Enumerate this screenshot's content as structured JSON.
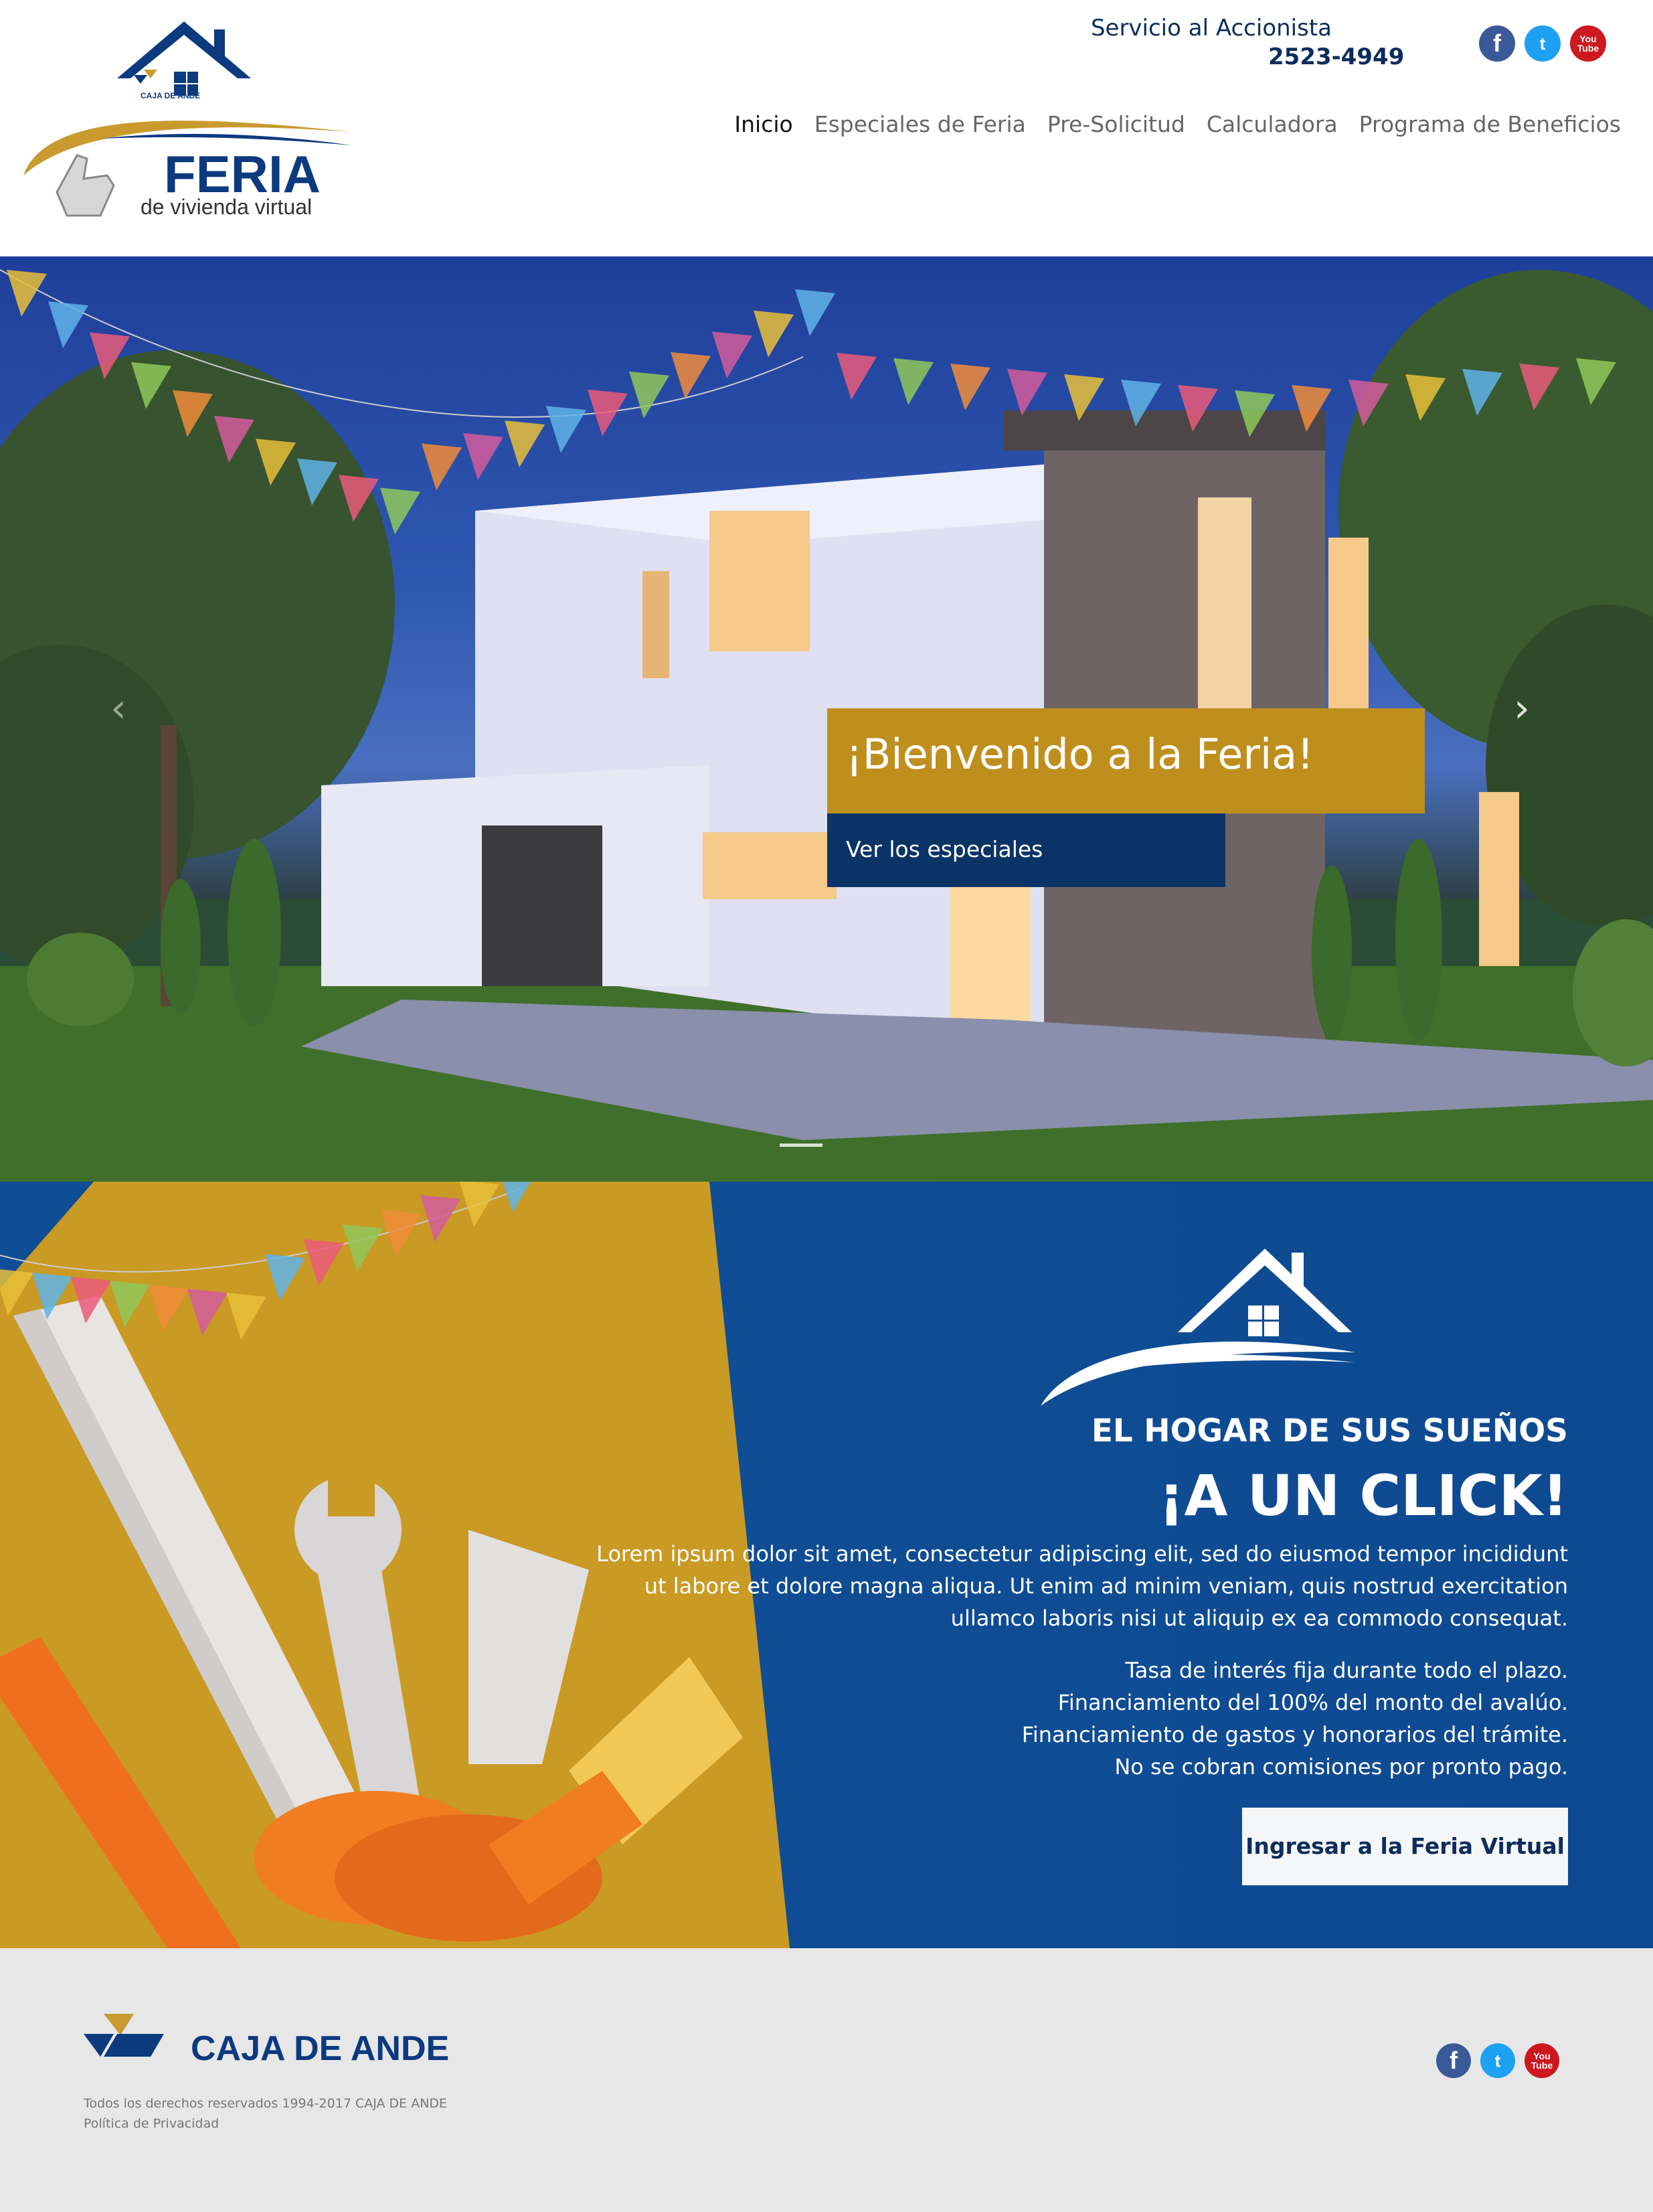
{
  "header": {
    "logo": {
      "brand_small": "CAJA DE ANDE",
      "title": "FERIA",
      "subtitle": "de vivienda virtual"
    },
    "service_label": "Servicio al Accionista",
    "service_phone": "2523-4949",
    "social": {
      "facebook": "f",
      "twitter": "t",
      "youtube_top": "You",
      "youtube_bottom": "Tube"
    },
    "nav": [
      {
        "label": "Inicio",
        "active": true
      },
      {
        "label": "Especiales de Feria"
      },
      {
        "label": "Pre-Solicitud"
      },
      {
        "label": "Calculadora"
      },
      {
        "label": "Programa de Beneficios"
      }
    ]
  },
  "hero": {
    "title": "¡Bienvenido a la Feria!",
    "button": "Ver los especiales",
    "prev_icon": "chevron-left-icon",
    "next_icon": "chevron-right-icon",
    "prev_glyph": "‹",
    "next_glyph": "›"
  },
  "promo": {
    "subtitle": "EL HOGAR DE SUS SUEÑOS",
    "headline": "¡A UN CLICK!",
    "body": [
      "Lorem ipsum dolor sit amet, consectetur adipiscing elit, sed do eiusmod tempor incididunt",
      "ut labore et dolore magna aliqua. Ut enim ad minim veniam, quis nostrud exercitation",
      "ullamco laboris nisi ut aliquip ex ea commodo consequat."
    ],
    "features": [
      "Tasa de interés fija durante todo el plazo.",
      "Financiamiento del 100% del monto del avalúo.",
      "Financiamiento de gastos y honorarios del trámite.",
      "No se cobran comisiones por pronto pago."
    ],
    "button": "Ingresar a la Feria Virtual"
  },
  "footer": {
    "brand": "CAJA DE ANDE",
    "copyright": "Todos los derechos reservados 1994-2017 CAJA DE ANDE",
    "privacy": "Política de Privacidad"
  },
  "colors": {
    "navy": "#0c2d5c",
    "gold": "#bf8f1e",
    "promo_blue": "#0e4a92",
    "footer_gray": "#e7e7e7"
  }
}
